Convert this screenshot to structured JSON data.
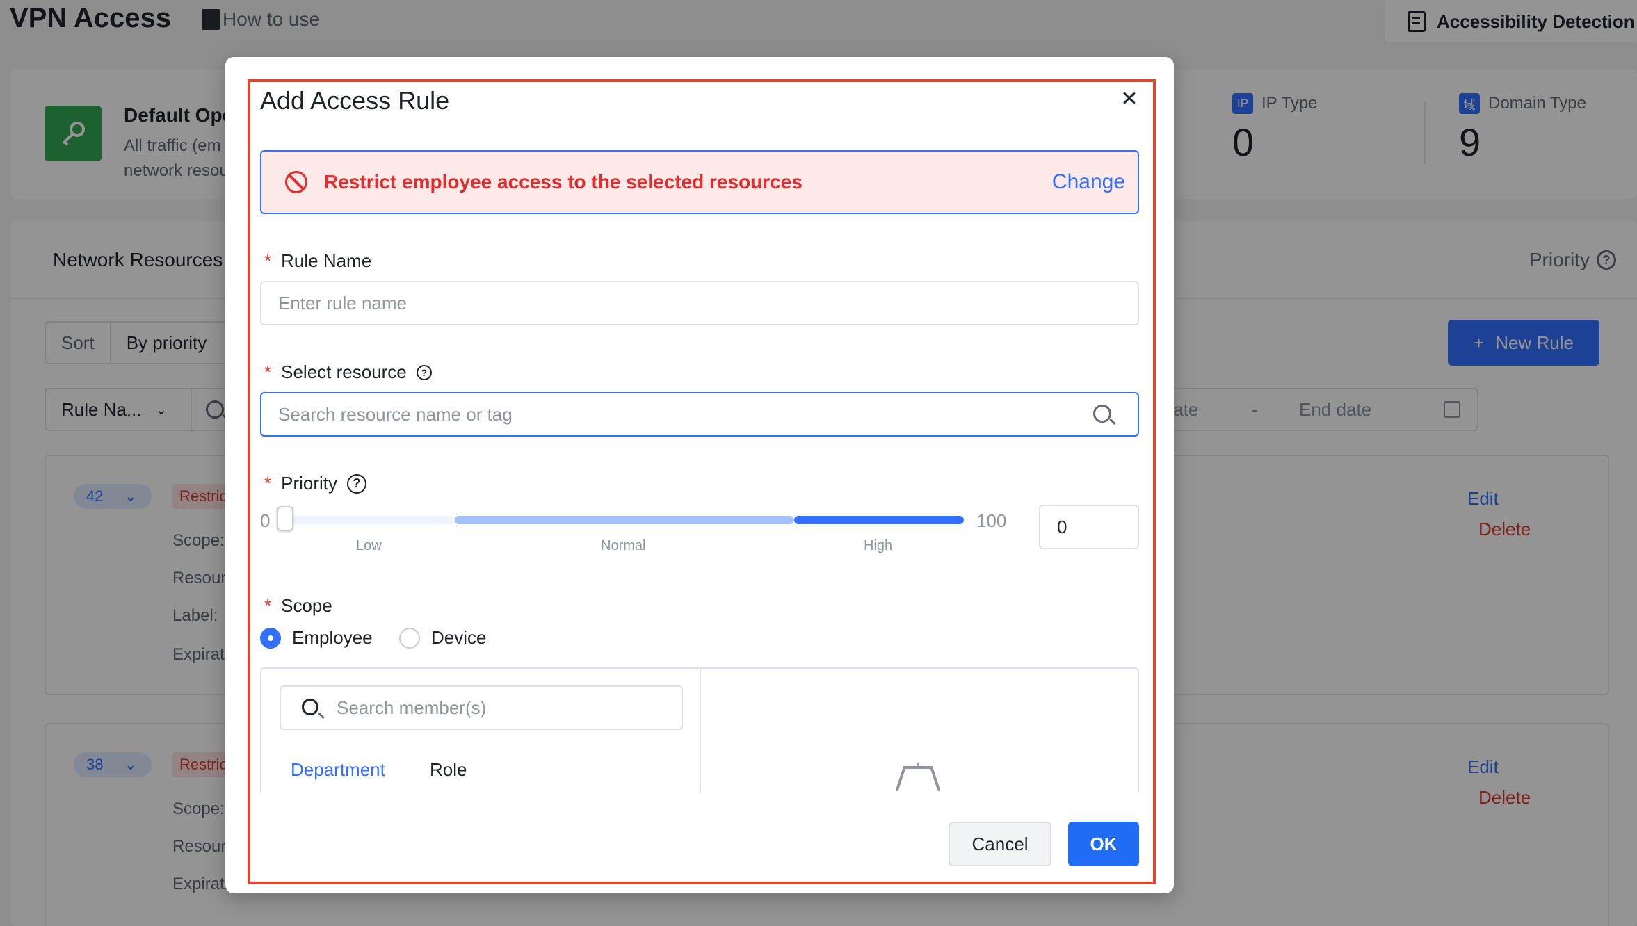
{
  "page": {
    "title": "VPN Access",
    "how_to_use": "How to use",
    "accessibility": "Accessibility Detection"
  },
  "summary": {
    "title": "Default Ope",
    "desc_line1": "All traffic (em",
    "desc_line2": "network resou",
    "stats": [
      {
        "icon": "IP",
        "label": "IP Type",
        "value": "0"
      },
      {
        "icon": "域",
        "label": "Domain Type",
        "value": "9"
      }
    ]
  },
  "main": {
    "tab": "Network Resources",
    "priority": "Priority",
    "sort_label": "Sort",
    "sort_value": "By priority",
    "new_rule": "New Rule",
    "filter_select": "Rule Na...",
    "date_start": "tart date",
    "date_sep": "-",
    "date_end": "End date"
  },
  "rules": [
    {
      "priority": "42",
      "tag": "Restric",
      "scope": "Scope:",
      "resource": "Resour",
      "label": "Label:",
      "expiration": "Expirati",
      "edit": "Edit",
      "delete": "Delete"
    },
    {
      "priority": "38",
      "tag": "Restric",
      "scope": "Scope:",
      "resource": "Resour",
      "expiration": "Expirati",
      "edit": "Edit",
      "delete": "Delete"
    }
  ],
  "modal": {
    "title": "Add Access Rule",
    "alert_text": "Restrict employee access to the selected resources",
    "alert_action": "Change",
    "rule_name_label": "Rule Name",
    "rule_name_placeholder": "Enter rule name",
    "resource_label": "Select resource",
    "resource_placeholder": "Search resource name or tag",
    "priority_label": "Priority",
    "slider": {
      "min": "0",
      "max": "100",
      "value": 0,
      "low": "Low",
      "normal": "Normal",
      "high": "High"
    },
    "priority_value": "0",
    "scope_label": "Scope",
    "scope_options": [
      {
        "label": "Employee",
        "selected": true
      },
      {
        "label": "Device",
        "selected": false
      }
    ],
    "member_search_placeholder": "Search member(s)",
    "member_tabs": [
      "Department",
      "Role"
    ],
    "cancel": "Cancel",
    "ok": "OK"
  },
  "colors": {
    "primary": "#3370ff",
    "danger": "#e02e2e",
    "highlight": "#e0452f"
  }
}
